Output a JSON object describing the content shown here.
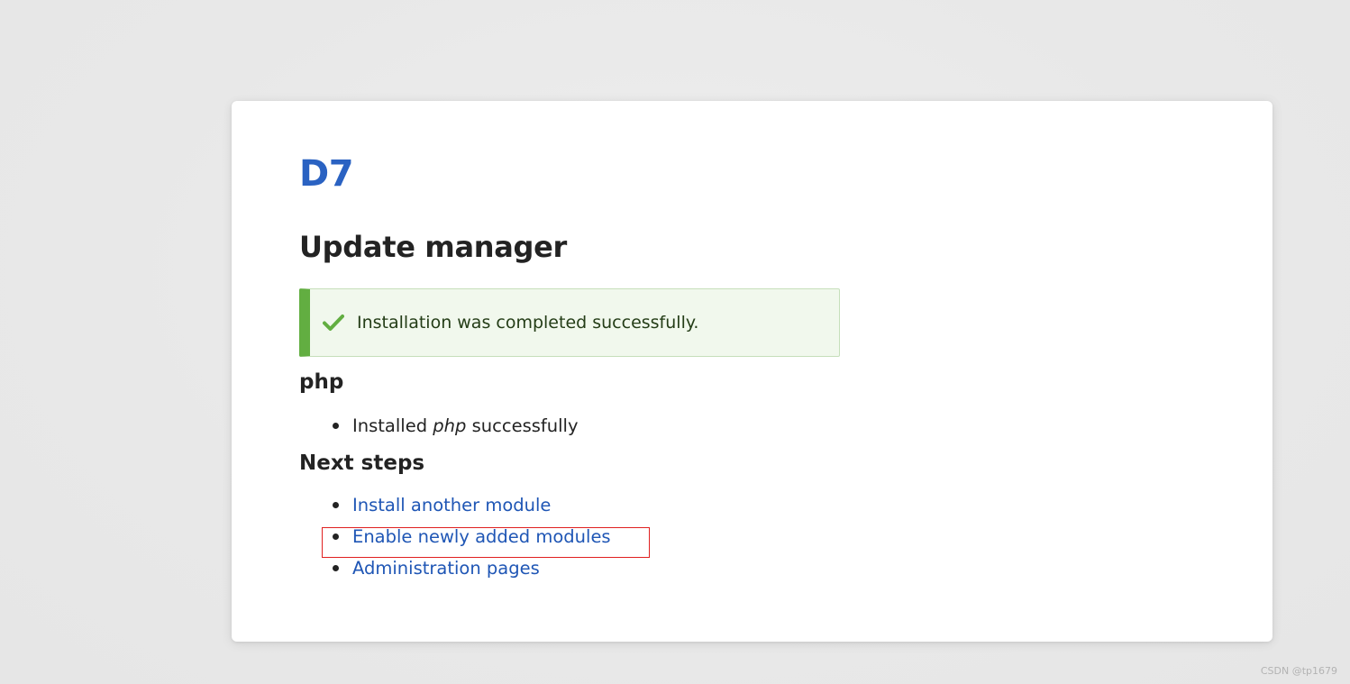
{
  "site": {
    "name": "D7"
  },
  "page": {
    "title": "Update manager"
  },
  "message": {
    "icon": "checkmark-icon",
    "text": "Installation was completed successfully.",
    "accent_color": "#62ae41"
  },
  "project": {
    "title": "php",
    "items": [
      {
        "prefix": "Installed ",
        "emphasis": "php",
        "suffix": " successfully"
      }
    ]
  },
  "next_steps": {
    "title": "Next steps",
    "links": [
      {
        "label": "Install another module"
      },
      {
        "label": "Enable newly added modules"
      },
      {
        "label": "Administration pages"
      }
    ]
  },
  "watermark": "CSDN @tp1679",
  "colors": {
    "link": "#1f56b5",
    "site_name": "#2a62c2",
    "annotation_box": "#e02020"
  }
}
